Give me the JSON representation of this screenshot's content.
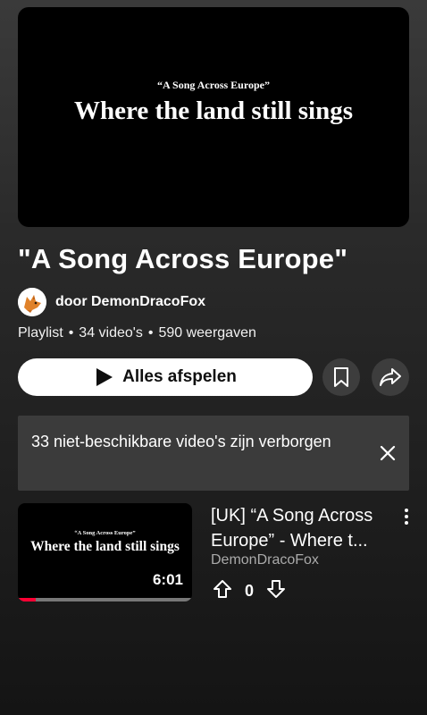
{
  "hero": {
    "subtitle": "“A Song Across Europe”",
    "title": "Where the land still sings"
  },
  "playlist": {
    "title": "\"A Song Across Europe\"",
    "owner": "door DemonDracoFox",
    "type": "Playlist",
    "video_count": "34 video's",
    "views": "590 weergaven",
    "separator": "•"
  },
  "actions": {
    "play_all_label": "Alles afspelen",
    "save_icon": "bookmark-icon",
    "share_icon": "share-icon"
  },
  "notice": {
    "text": "33 niet-beschikbare video's zijn verborgen",
    "close_icon": "close-icon"
  },
  "video": {
    "thumb_subtitle": "“A Song Across Europe”",
    "thumb_title": "Where the land still sings",
    "duration": "6:01",
    "progress_percent": 10,
    "title": "[UK] “A Song Across Europe” - Where t...",
    "channel": "DemonDracoFox",
    "votes": "0"
  },
  "colors": {
    "accent": "#ff0033",
    "button_bg": "#ffffff",
    "notice_bg": "#3b3b3b",
    "secondary_text": "#aaaaaa"
  }
}
